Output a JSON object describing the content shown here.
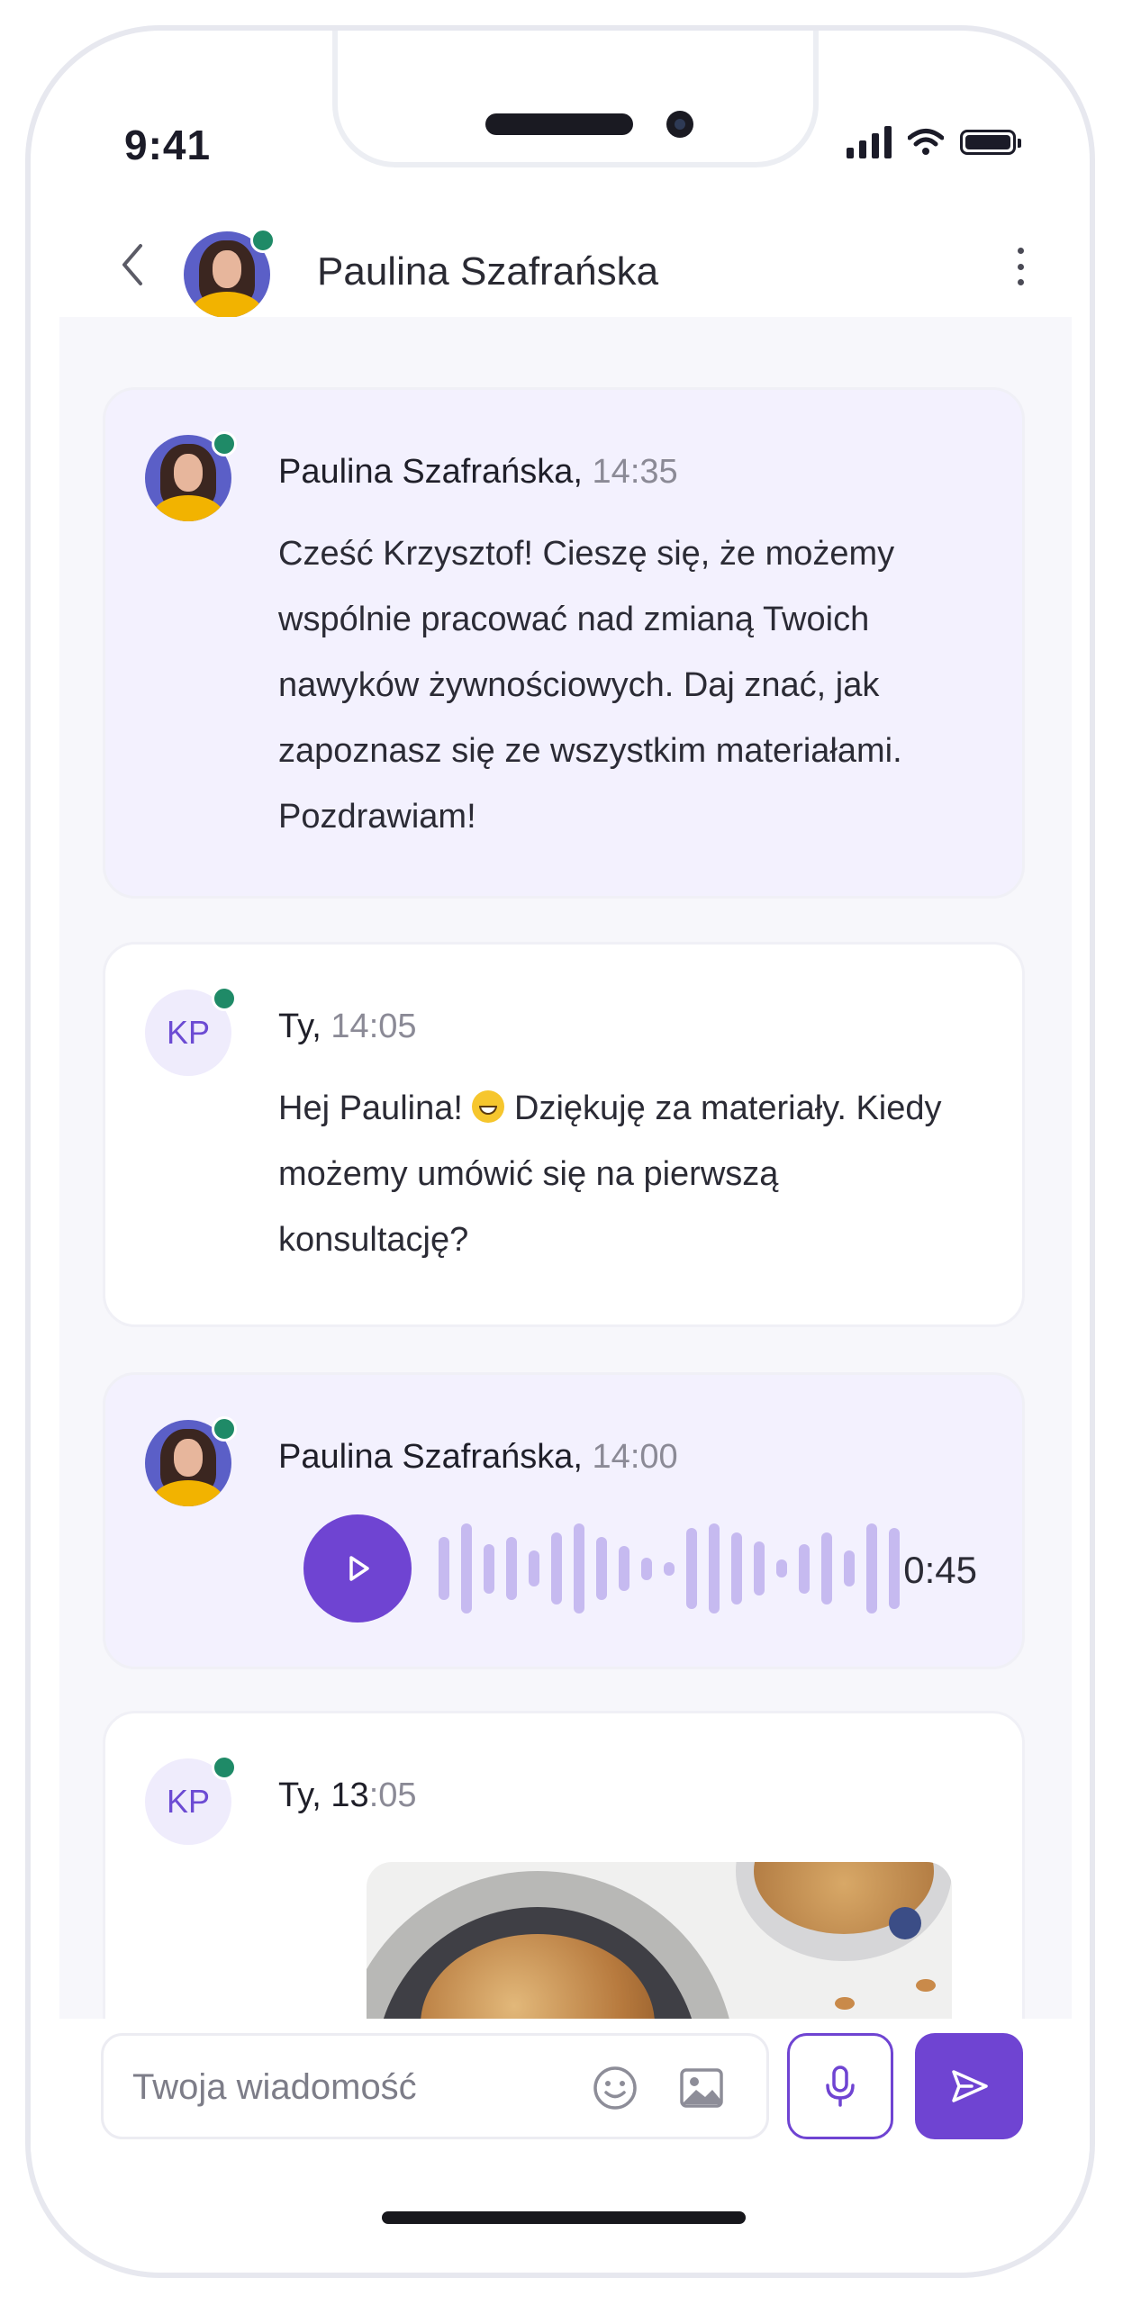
{
  "status_bar": {
    "time": "9:41"
  },
  "header": {
    "contact_name": "Paulina Szafrańska",
    "online": true
  },
  "messages": [
    {
      "type": "text",
      "direction": "received",
      "author": "Paulina Szafrańska,",
      "time": "14:35",
      "text": "Cześć Krzysztof! Cieszę się, że możemy wspólnie pracować nad zmianą Twoich nawyków żywnościowych. Daj znać, jak zapoznasz się ze wszystkim materiałami. Pozdrawiam!"
    },
    {
      "type": "text",
      "direction": "sent",
      "author": "Ty,",
      "time": "14:05",
      "initials": "KP",
      "text_before_emoji": "Hej Paulina! ",
      "text_after_emoji": " Dziękuję za materiały. Kiedy możemy umówić się na pierwszą konsultację?"
    },
    {
      "type": "voice",
      "direction": "received",
      "author": "Paulina Szafrańska,",
      "time": "14:00",
      "duration": "0:45"
    },
    {
      "type": "image",
      "direction": "sent",
      "author": "Ty,",
      "time_hour": "13",
      "time_rest": ":05",
      "initials": "KP",
      "image_alt": "granola-bowls-photo"
    }
  ],
  "composer": {
    "placeholder": "Twoja wiadomość"
  },
  "colors": {
    "accent": "#6f44d2",
    "received_bubble": "#f3f1fe",
    "online": "#1f8a67",
    "waveform": "#c6baf0"
  }
}
